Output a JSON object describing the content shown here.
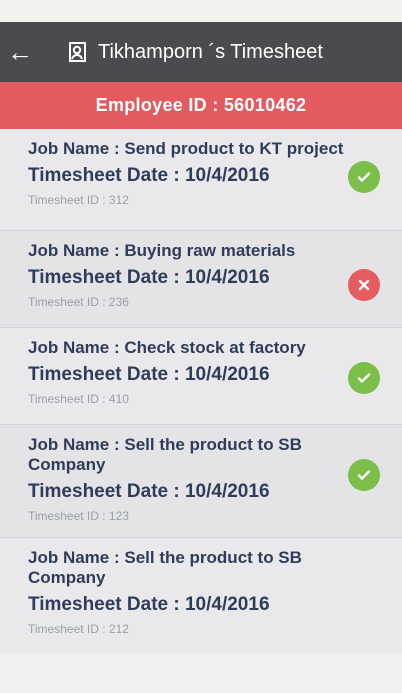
{
  "app_bar": {
    "title": "Tikhamporn ´s Timesheet",
    "back_icon": "arrow-left-icon",
    "user_icon": "user-icon"
  },
  "employee": {
    "label": "Employee ID : 56010462"
  },
  "colors": {
    "app_bar": "#4b4b4f",
    "employee_band": "#e35b5f",
    "approved": "#7bbf4a",
    "rejected": "#e55b5e",
    "text": "#2f3d5a"
  },
  "timesheets": [
    {
      "job": "Job Name : Send product to KT project",
      "date": "Timesheet Date : 10/4/2016",
      "id": "Timesheet ID : 312",
      "status": "approved"
    },
    {
      "job": "Job Name : Buying raw materials",
      "date": "Timesheet Date : 10/4/2016",
      "id": "Timesheet ID : 236",
      "status": "rejected"
    },
    {
      "job": "Job Name : Check stock at factory",
      "date": "Timesheet Date : 10/4/2016",
      "id": "Timesheet ID : 410",
      "status": "approved"
    },
    {
      "job": "Job Name : Sell the product to SB Company",
      "date": "Timesheet Date : 10/4/2016",
      "id": "Timesheet ID : 123",
      "status": "approved"
    },
    {
      "job": "Job Name : Sell the product to SB Company",
      "date": "Timesheet Date : 10/4/2016",
      "id": "Timesheet ID : 212",
      "status": "none"
    }
  ]
}
